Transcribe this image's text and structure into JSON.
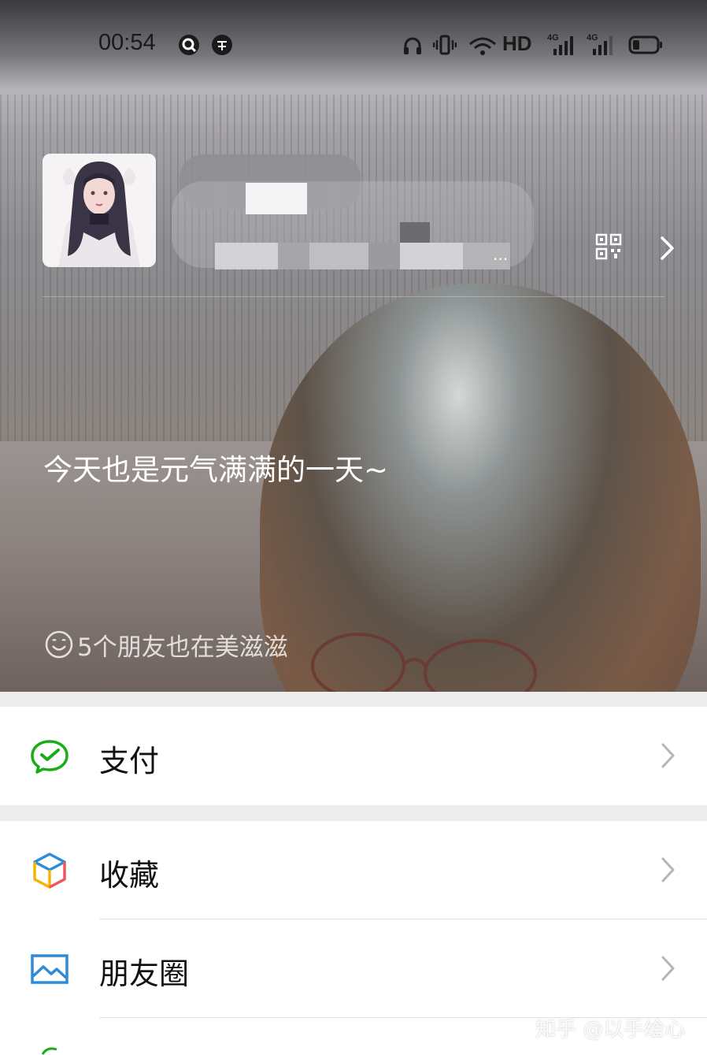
{
  "status_bar": {
    "time": "00:54",
    "network_label": "HD",
    "icons": [
      "q-app-icon",
      "zhihu-icon",
      "headset-icon",
      "vibrate-icon",
      "wifi-icon",
      "hd-icon",
      "signal-4g-icon",
      "signal-4g-icon",
      "battery-icon"
    ]
  },
  "profile": {
    "signature": "今天也是元气满满的一天~",
    "friends_status": "5个朋友也在美滋滋",
    "name_blurred": true
  },
  "menu": {
    "pay_label": "支付",
    "favorites_label": "收藏",
    "moments_label": "朋友圈"
  },
  "colors": {
    "pay_green": "#1aad19",
    "moments_blue": "#2f8ad8",
    "list_bg": "#ffffff",
    "page_bg": "#ededed"
  },
  "watermark": "知乎 @以手绘心"
}
